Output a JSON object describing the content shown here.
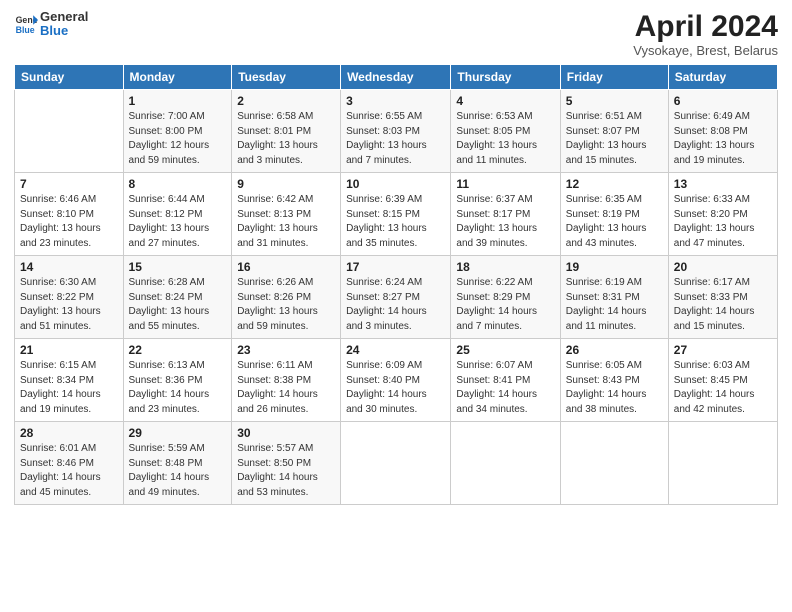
{
  "header": {
    "logo_line1": "General",
    "logo_line2": "Blue",
    "title": "April 2024",
    "subtitle": "Vysokaye, Brest, Belarus"
  },
  "weekdays": [
    "Sunday",
    "Monday",
    "Tuesday",
    "Wednesday",
    "Thursday",
    "Friday",
    "Saturday"
  ],
  "weeks": [
    [
      {
        "day": "",
        "info": ""
      },
      {
        "day": "1",
        "info": "Sunrise: 7:00 AM\nSunset: 8:00 PM\nDaylight: 12 hours\nand 59 minutes."
      },
      {
        "day": "2",
        "info": "Sunrise: 6:58 AM\nSunset: 8:01 PM\nDaylight: 13 hours\nand 3 minutes."
      },
      {
        "day": "3",
        "info": "Sunrise: 6:55 AM\nSunset: 8:03 PM\nDaylight: 13 hours\nand 7 minutes."
      },
      {
        "day": "4",
        "info": "Sunrise: 6:53 AM\nSunset: 8:05 PM\nDaylight: 13 hours\nand 11 minutes."
      },
      {
        "day": "5",
        "info": "Sunrise: 6:51 AM\nSunset: 8:07 PM\nDaylight: 13 hours\nand 15 minutes."
      },
      {
        "day": "6",
        "info": "Sunrise: 6:49 AM\nSunset: 8:08 PM\nDaylight: 13 hours\nand 19 minutes."
      }
    ],
    [
      {
        "day": "7",
        "info": "Sunrise: 6:46 AM\nSunset: 8:10 PM\nDaylight: 13 hours\nand 23 minutes."
      },
      {
        "day": "8",
        "info": "Sunrise: 6:44 AM\nSunset: 8:12 PM\nDaylight: 13 hours\nand 27 minutes."
      },
      {
        "day": "9",
        "info": "Sunrise: 6:42 AM\nSunset: 8:13 PM\nDaylight: 13 hours\nand 31 minutes."
      },
      {
        "day": "10",
        "info": "Sunrise: 6:39 AM\nSunset: 8:15 PM\nDaylight: 13 hours\nand 35 minutes."
      },
      {
        "day": "11",
        "info": "Sunrise: 6:37 AM\nSunset: 8:17 PM\nDaylight: 13 hours\nand 39 minutes."
      },
      {
        "day": "12",
        "info": "Sunrise: 6:35 AM\nSunset: 8:19 PM\nDaylight: 13 hours\nand 43 minutes."
      },
      {
        "day": "13",
        "info": "Sunrise: 6:33 AM\nSunset: 8:20 PM\nDaylight: 13 hours\nand 47 minutes."
      }
    ],
    [
      {
        "day": "14",
        "info": "Sunrise: 6:30 AM\nSunset: 8:22 PM\nDaylight: 13 hours\nand 51 minutes."
      },
      {
        "day": "15",
        "info": "Sunrise: 6:28 AM\nSunset: 8:24 PM\nDaylight: 13 hours\nand 55 minutes."
      },
      {
        "day": "16",
        "info": "Sunrise: 6:26 AM\nSunset: 8:26 PM\nDaylight: 13 hours\nand 59 minutes."
      },
      {
        "day": "17",
        "info": "Sunrise: 6:24 AM\nSunset: 8:27 PM\nDaylight: 14 hours\nand 3 minutes."
      },
      {
        "day": "18",
        "info": "Sunrise: 6:22 AM\nSunset: 8:29 PM\nDaylight: 14 hours\nand 7 minutes."
      },
      {
        "day": "19",
        "info": "Sunrise: 6:19 AM\nSunset: 8:31 PM\nDaylight: 14 hours\nand 11 minutes."
      },
      {
        "day": "20",
        "info": "Sunrise: 6:17 AM\nSunset: 8:33 PM\nDaylight: 14 hours\nand 15 minutes."
      }
    ],
    [
      {
        "day": "21",
        "info": "Sunrise: 6:15 AM\nSunset: 8:34 PM\nDaylight: 14 hours\nand 19 minutes."
      },
      {
        "day": "22",
        "info": "Sunrise: 6:13 AM\nSunset: 8:36 PM\nDaylight: 14 hours\nand 23 minutes."
      },
      {
        "day": "23",
        "info": "Sunrise: 6:11 AM\nSunset: 8:38 PM\nDaylight: 14 hours\nand 26 minutes."
      },
      {
        "day": "24",
        "info": "Sunrise: 6:09 AM\nSunset: 8:40 PM\nDaylight: 14 hours\nand 30 minutes."
      },
      {
        "day": "25",
        "info": "Sunrise: 6:07 AM\nSunset: 8:41 PM\nDaylight: 14 hours\nand 34 minutes."
      },
      {
        "day": "26",
        "info": "Sunrise: 6:05 AM\nSunset: 8:43 PM\nDaylight: 14 hours\nand 38 minutes."
      },
      {
        "day": "27",
        "info": "Sunrise: 6:03 AM\nSunset: 8:45 PM\nDaylight: 14 hours\nand 42 minutes."
      }
    ],
    [
      {
        "day": "28",
        "info": "Sunrise: 6:01 AM\nSunset: 8:46 PM\nDaylight: 14 hours\nand 45 minutes."
      },
      {
        "day": "29",
        "info": "Sunrise: 5:59 AM\nSunset: 8:48 PM\nDaylight: 14 hours\nand 49 minutes."
      },
      {
        "day": "30",
        "info": "Sunrise: 5:57 AM\nSunset: 8:50 PM\nDaylight: 14 hours\nand 53 minutes."
      },
      {
        "day": "",
        "info": ""
      },
      {
        "day": "",
        "info": ""
      },
      {
        "day": "",
        "info": ""
      },
      {
        "day": "",
        "info": ""
      }
    ]
  ]
}
